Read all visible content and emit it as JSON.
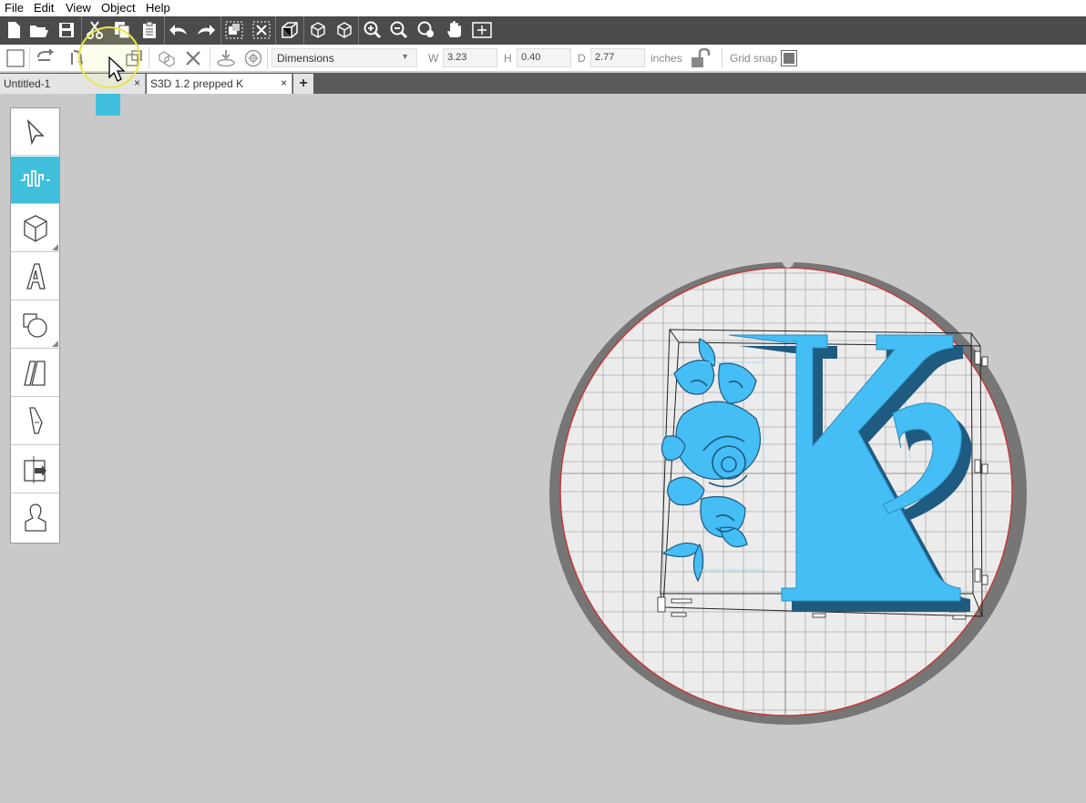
{
  "menu": [
    "File",
    "Edit",
    "View",
    "Object",
    "Help"
  ],
  "dimensions": {
    "mode": "Dimensions",
    "w_label": "W",
    "w_value": "3.23",
    "h_label": "H",
    "h_value": "0.40",
    "d_label": "D",
    "d_value": "2.77",
    "units": "inches",
    "grid_snap_label": "Grid snap"
  },
  "tabs": [
    {
      "label": "Untitled-1",
      "close": "×"
    },
    {
      "label": "S3D 1.2 prepped K",
      "close": "×"
    }
  ],
  "add_tab": "+",
  "model": {
    "letter": "K",
    "color": "#45bdf5",
    "accent": "#3fbfdc"
  }
}
